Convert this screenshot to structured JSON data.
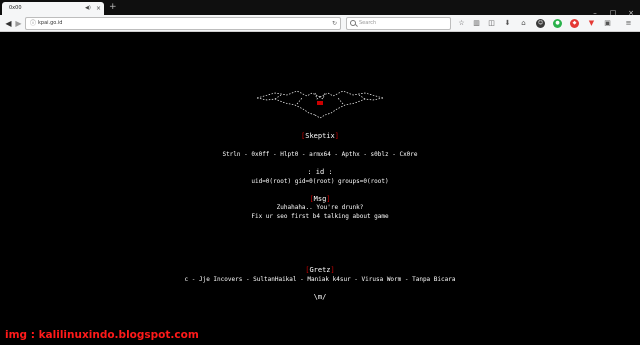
{
  "browser": {
    "tab_title": "0x00",
    "tab_audio_icon": "speaker-icon",
    "tab_close": "×",
    "new_tab": "+",
    "window_controls": [
      "–",
      "□",
      "×"
    ],
    "url": "kpai.go.id",
    "search_placeholder": "Search"
  },
  "page": {
    "skeptix": {
      "open": "[",
      "label": "Skeptix",
      "close": "]"
    },
    "members": "Strln - 0x0ff - Hlpt0 - armx64 - Apthx - s0blz - Cx0re",
    "id_heading": ": id :",
    "id_output": "uid=0(root) gid=0(root) groups=0(root)",
    "msg": {
      "open": "[",
      "label": "Msg",
      "close": "]"
    },
    "msg_line1": "Zuhahaha.. You're drunk?",
    "msg_line2": "Fix ur seo first b4 talking about game",
    "gretz": {
      "open": "[",
      "label": "Gretz",
      "close": "]"
    },
    "gretz_line": "c - Jje Incovers - SultanHaikal - Maniak k4sur - Virusa Worm - Tanpa Bicara",
    "signoff": "\\m/"
  },
  "watermark": "img : kalilinuxindo.blogspot.com",
  "colors": {
    "background": "#000000",
    "text": "#ffffff",
    "accent_red": "#cc0000",
    "watermark_red": "#ff1a1a"
  }
}
